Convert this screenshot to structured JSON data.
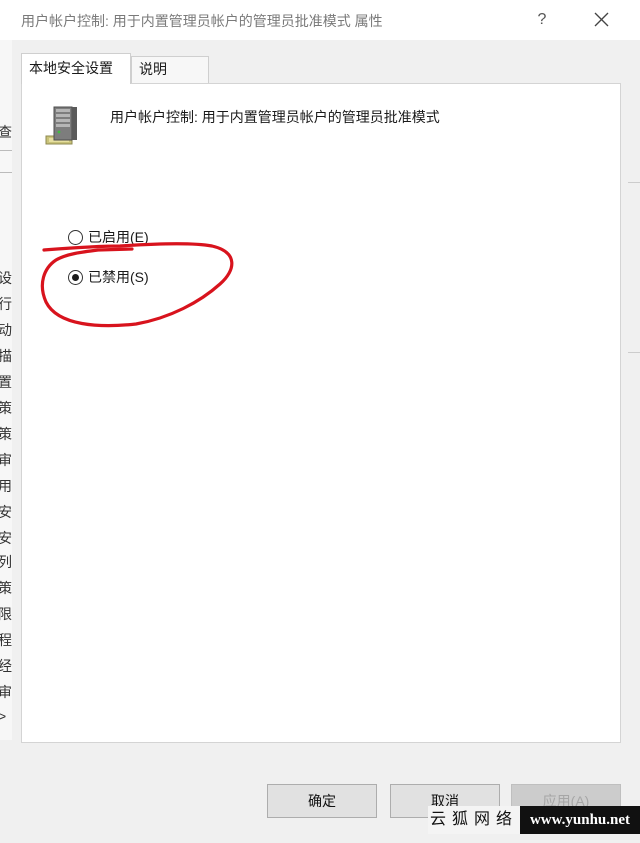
{
  "window": {
    "title": "用户帐户控制: 用于内置管理员帐户的管理员批准模式 属性",
    "help_label": "?"
  },
  "tabs": [
    {
      "label": "本地安全设置",
      "active": true
    },
    {
      "label": "说明",
      "active": false
    }
  ],
  "policy": {
    "icon": "server-icon",
    "title": "用户帐户控制: 用于内置管理员帐户的管理员批准模式"
  },
  "options": {
    "enabled_label": "已启用(E)",
    "disabled_label": "已禁用(S)",
    "selected": "disabled"
  },
  "buttons": {
    "ok_label": "确定",
    "cancel_label": "取消",
    "apply_label": "应用(A)",
    "apply_enabled": false
  },
  "background_chars": [
    "查",
    "设",
    "行",
    "动",
    "描",
    "置",
    "策",
    "策",
    "审",
    "用",
    "安",
    "安",
    "列",
    "策",
    "限",
    "程",
    "经",
    "审",
    ">"
  ],
  "annotation_color": "#d8131d",
  "watermark": {
    "left_text": "云狐网络",
    "right_text": "www.yunhu.net"
  }
}
